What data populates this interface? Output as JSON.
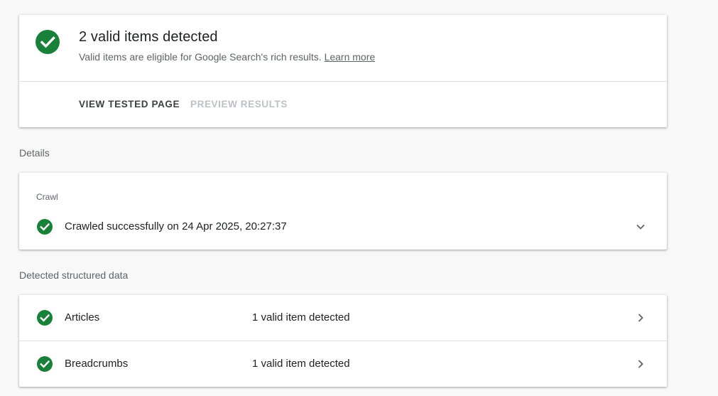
{
  "colors": {
    "success_green": "#188038",
    "background": "#f8f8f8",
    "card": "#ffffff",
    "secondary_text": "#5f6368",
    "disabled_text": "#bdc1c6"
  },
  "summary": {
    "icon": "check-circle-icon",
    "title": "2 valid items detected",
    "subtitle": "Valid items are eligible for Google Search's rich results.",
    "learn_more": "Learn more",
    "actions": {
      "view_tested_page": "VIEW TESTED PAGE",
      "preview_results": "PREVIEW RESULTS"
    }
  },
  "details": {
    "section_label": "Details",
    "crawl": {
      "header": "Crawl",
      "icon": "check-circle-icon",
      "text": "Crawled successfully on 24 Apr 2025, 20:27:37",
      "expand_icon": "chevron-down-icon"
    }
  },
  "structured_data": {
    "section_label": "Detected structured data",
    "items": [
      {
        "name": "Articles",
        "status": "1 valid item detected",
        "icon": "check-circle-icon",
        "nav_icon": "chevron-right-icon"
      },
      {
        "name": "Breadcrumbs",
        "status": "1 valid item detected",
        "icon": "check-circle-icon",
        "nav_icon": "chevron-right-icon"
      }
    ]
  }
}
